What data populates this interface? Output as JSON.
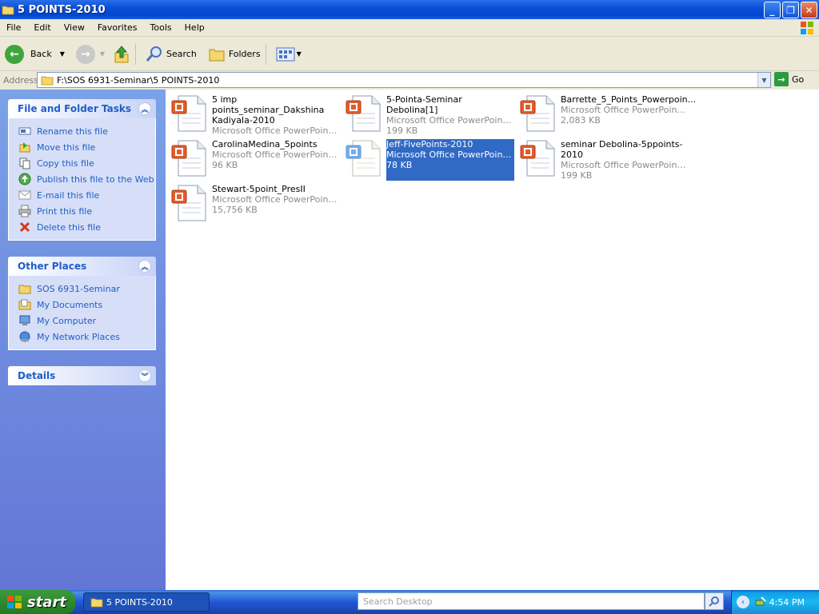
{
  "window": {
    "title": "5 POINTS-2010"
  },
  "menu": [
    "File",
    "Edit",
    "View",
    "Favorites",
    "Tools",
    "Help"
  ],
  "toolbar": {
    "back": "Back",
    "search": "Search",
    "folders": "Folders"
  },
  "address": {
    "label": "Address",
    "path": "F:\\SOS 6931-Seminar\\5 POINTS-2010",
    "go": "Go"
  },
  "tasks": {
    "title": "File and Folder Tasks",
    "items": [
      {
        "label": "Rename this file",
        "icon": "rename-icon"
      },
      {
        "label": "Move this file",
        "icon": "move-icon"
      },
      {
        "label": "Copy this file",
        "icon": "copy-icon"
      },
      {
        "label": "Publish this file to the Web",
        "icon": "globe-icon"
      },
      {
        "label": "E-mail this file",
        "icon": "mail-icon"
      },
      {
        "label": "Print this file",
        "icon": "printer-icon"
      },
      {
        "label": "Delete this file",
        "icon": "delete-icon"
      }
    ]
  },
  "other_places": {
    "title": "Other Places",
    "items": [
      {
        "label": "SOS 6931-Seminar",
        "icon": "folder-icon"
      },
      {
        "label": "My Documents",
        "icon": "documents-icon"
      },
      {
        "label": "My Computer",
        "icon": "computer-icon"
      },
      {
        "label": "My Network Places",
        "icon": "network-icon"
      }
    ]
  },
  "details": {
    "title": "Details"
  },
  "files": [
    {
      "name": "5 imp points_seminar_Dakshina Kadiyala-2010",
      "meta": "Microsoft Office PowerPoint 9...",
      "selected": false
    },
    {
      "name": "5-Pointa-Seminar Debolina[1]",
      "type": "Microsoft Office PowerPoint Pr...",
      "size": "199 KB",
      "selected": false
    },
    {
      "name": "Barrette_5_Points_Powerpoin...",
      "type": "Microsoft Office PowerPoint 9...",
      "size": "2,083 KB",
      "selected": false
    },
    {
      "name": "CarolinaMedina_5points",
      "type": "Microsoft Office PowerPoint Pr...",
      "size": "96 KB",
      "selected": false
    },
    {
      "name": "Jeff-FivePoints-2010",
      "type": "Microsoft Office PowerPoint Pr...",
      "size": "78 KB",
      "selected": true
    },
    {
      "name": "seminar Debolina-5ppoints-2010",
      "type": "Microsoft Office PowerPoint Pr...",
      "size": "199 KB",
      "selected": false
    },
    {
      "name": "Stewart-5point_PresII",
      "type": "Microsoft Office PowerPoint Pr...",
      "size": "15,756 KB",
      "selected": false
    }
  ],
  "taskbar": {
    "start": "start",
    "window_button": "5 POINTS-2010",
    "search_placeholder": "Search Desktop",
    "clock": "4:54 PM"
  },
  "colors": {
    "title_blue": "#0046d0",
    "task_link": "#215dc6",
    "selection": "#316ac5",
    "start_green": "#2f8a2f"
  }
}
